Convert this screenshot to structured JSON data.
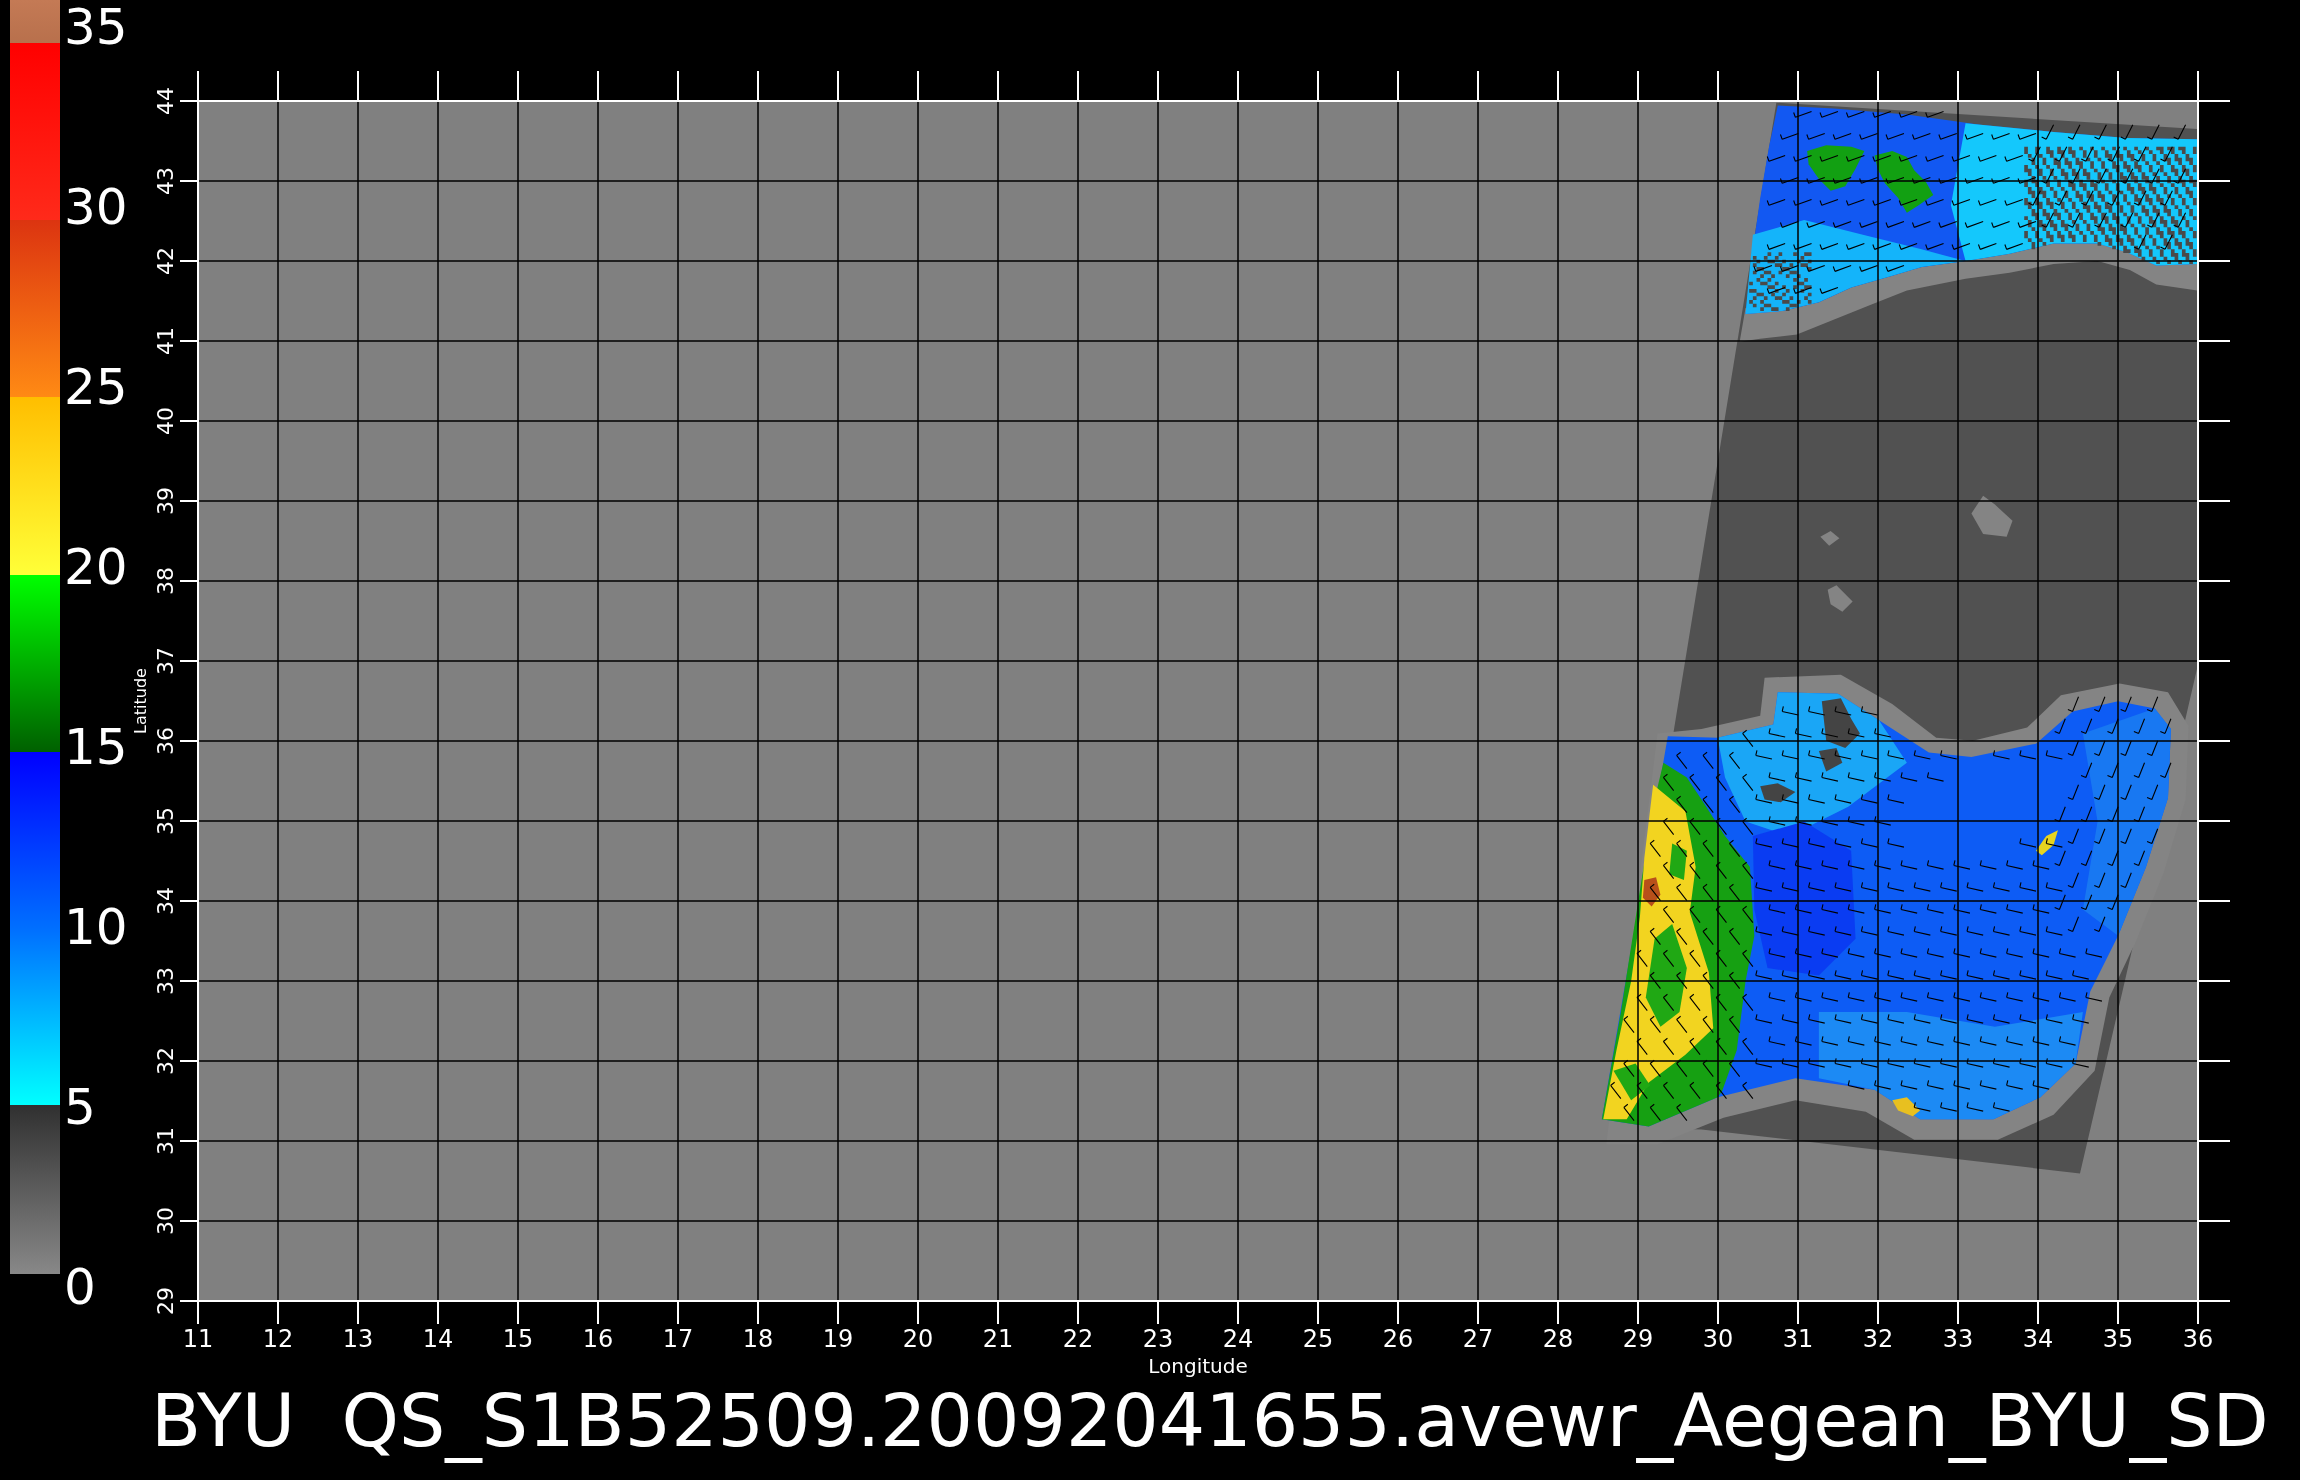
{
  "colorbar": {
    "ticks": [
      "35",
      "30",
      "25",
      "20",
      "15",
      "10",
      "5",
      "0"
    ]
  },
  "map": {
    "y_axis": {
      "label": "Latitude",
      "ticks": [
        "44",
        "43",
        "42",
        "41",
        "40",
        "39",
        "38",
        "37",
        "36",
        "35",
        "34",
        "33",
        "32",
        "31",
        "30",
        "29"
      ]
    },
    "x_axis": {
      "label": "Longitude",
      "ticks": [
        "11",
        "12",
        "13",
        "14",
        "15",
        "16",
        "17",
        "18",
        "19",
        "20",
        "21",
        "22",
        "23",
        "24",
        "25",
        "26",
        "27",
        "28",
        "29",
        "30",
        "31",
        "32",
        "33",
        "34",
        "35",
        "36"
      ]
    }
  },
  "title": "BYU  QS_S1B52509.20092041655.avewr_Aegean_BYU_SD"
}
